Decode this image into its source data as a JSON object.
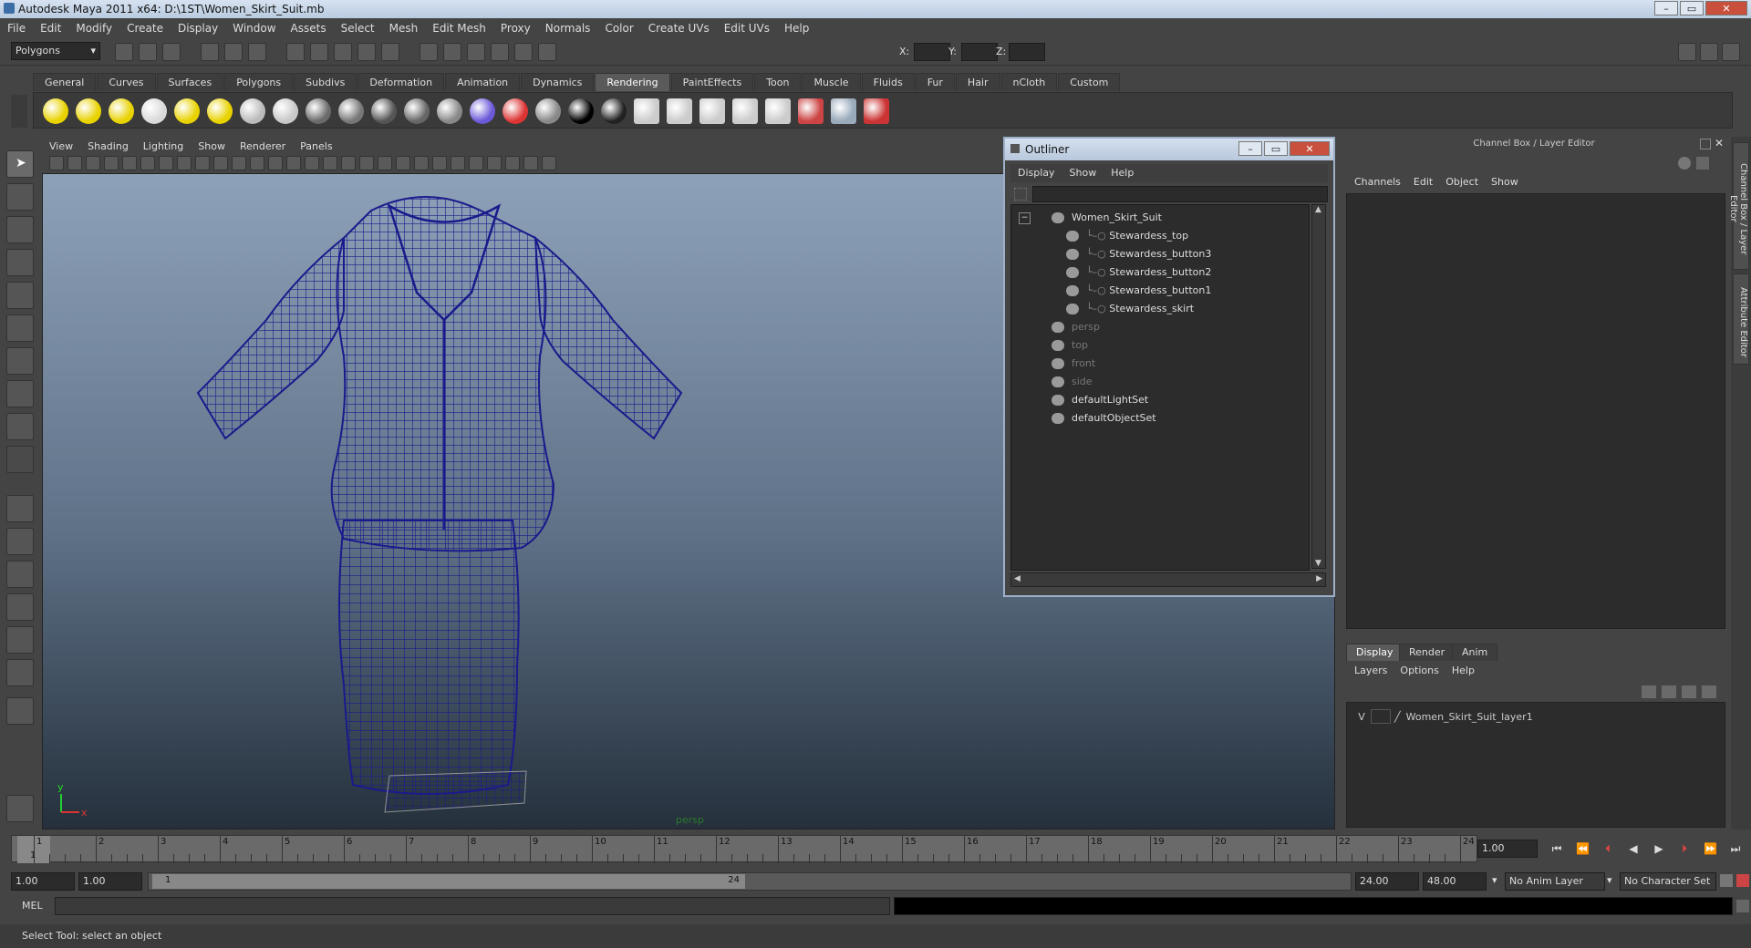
{
  "window": {
    "title": "Autodesk Maya 2011 x64: D:\\1ST\\Women_Skirt_Suit.mb"
  },
  "menus": [
    "File",
    "Edit",
    "Modify",
    "Create",
    "Display",
    "Window",
    "Assets",
    "Select",
    "Mesh",
    "Edit Mesh",
    "Proxy",
    "Normals",
    "Color",
    "Create UVs",
    "Edit UVs",
    "Help"
  ],
  "status_line": {
    "mode": "Polygons",
    "x_label": "X:",
    "y_label": "Y:",
    "z_label": "Z:"
  },
  "shelf_tabs": [
    "General",
    "Curves",
    "Surfaces",
    "Polygons",
    "Subdivs",
    "Deformation",
    "Animation",
    "Dynamics",
    "Rendering",
    "PaintEffects",
    "Toon",
    "Muscle",
    "Fluids",
    "Fur",
    "Hair",
    "nCloth",
    "Custom"
  ],
  "shelf_active": "Rendering",
  "viewport": {
    "menus": [
      "View",
      "Shading",
      "Lighting",
      "Show",
      "Renderer",
      "Panels"
    ],
    "camera_label": "persp",
    "axis_y": "y",
    "axis_x": "x"
  },
  "outliner": {
    "title": "Outliner",
    "menus": [
      "Display",
      "Show",
      "Help"
    ],
    "items": [
      {
        "label": "Women_Skirt_Suit",
        "indent": 0,
        "dim": false,
        "expand": "−"
      },
      {
        "label": "Stewardess_top",
        "indent": 1,
        "dim": false
      },
      {
        "label": "Stewardess_button3",
        "indent": 1,
        "dim": false
      },
      {
        "label": "Stewardess_button2",
        "indent": 1,
        "dim": false
      },
      {
        "label": "Stewardess_button1",
        "indent": 1,
        "dim": false
      },
      {
        "label": "Stewardess_skirt",
        "indent": 1,
        "dim": false
      },
      {
        "label": "persp",
        "indent": 0,
        "dim": true
      },
      {
        "label": "top",
        "indent": 0,
        "dim": true
      },
      {
        "label": "front",
        "indent": 0,
        "dim": true
      },
      {
        "label": "side",
        "indent": 0,
        "dim": true
      },
      {
        "label": "defaultLightSet",
        "indent": 0,
        "dim": false
      },
      {
        "label": "defaultObjectSet",
        "indent": 0,
        "dim": false
      }
    ]
  },
  "channel_box": {
    "title": "Channel Box / Layer Editor",
    "menus": [
      "Channels",
      "Edit",
      "Object",
      "Show"
    ],
    "layer_tabs": [
      "Display",
      "Render",
      "Anim"
    ],
    "layer_active": "Display",
    "layer_menus": [
      "Layers",
      "Options",
      "Help"
    ],
    "layer": {
      "visible": "V",
      "name": "Women_Skirt_Suit_layer1"
    }
  },
  "side_tabs": [
    "Channel Box / Layer Editor",
    "Attribute Editor"
  ],
  "time_slider": {
    "ticks": [
      "1",
      "2",
      "3",
      "4",
      "5",
      "6",
      "7",
      "8",
      "9",
      "10",
      "11",
      "12",
      "13",
      "14",
      "15",
      "16",
      "17",
      "18",
      "19",
      "20",
      "21",
      "22",
      "23",
      "24"
    ],
    "current_frame": "1",
    "current_field": "1.00"
  },
  "range_slider": {
    "start_time": "1.00",
    "playback_start": "1.00",
    "range_start": "1",
    "range_end": "24",
    "playback_end": "24.00",
    "end_time": "48.00",
    "anim_layer": "No Anim Layer",
    "character_set": "No Character Set"
  },
  "command_line": {
    "label": "MEL"
  },
  "help_line": {
    "text": "Select Tool: select an object"
  },
  "colors": {
    "wire": "#1a1a8c",
    "accent_tab": "#5a5a5a"
  }
}
